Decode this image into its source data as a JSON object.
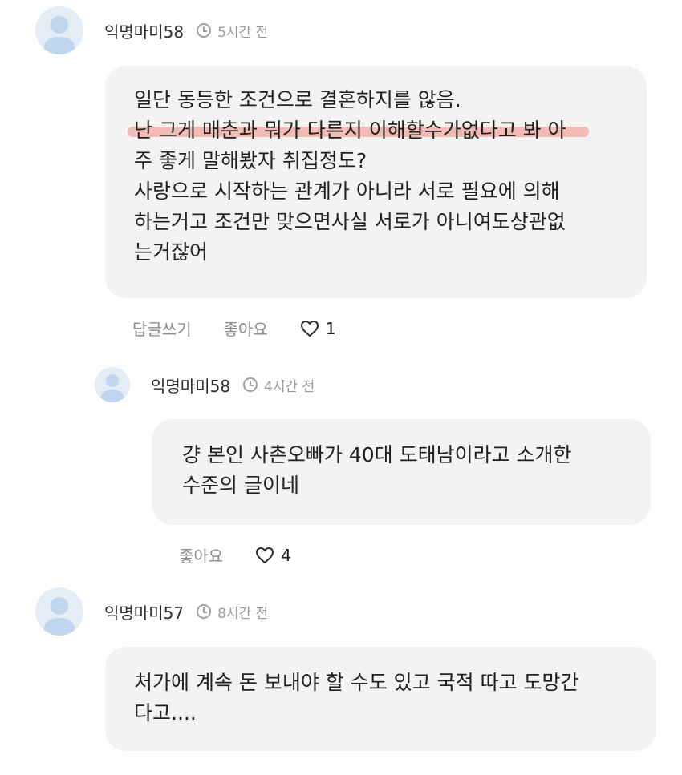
{
  "comments": [
    {
      "author": "익명마미58",
      "time": "5시간 전",
      "lines": [
        "일단 동등한 조건으로 결혼하지를 않음.",
        "난 그게 매춘과 뭐가 다른지 이해할수가없다고 봐 아",
        "주 좋게 말해봤자 취집정도?",
        "사랑으로 시작하는 관계가 아니라 서로 필요에 의해",
        "하는거고 조건만 맞으면사실 서로가 아니여도상관없",
        "는거잖어"
      ],
      "reply_label": "답글쓰기",
      "like_label": "좋아요",
      "like_count": "1"
    },
    {
      "author": "익명마미58",
      "time": "4시간 전",
      "lines": [
        "걍 본인 사촌오빠가 40대 도태남이라고 소개한",
        "수준의 글이네"
      ],
      "like_label": "좋아요",
      "like_count": "4"
    },
    {
      "author": "익명마미57",
      "time": "8시간 전",
      "lines": [
        "처가에 계속 돈 보내야 할 수도 있고 국적 따고 도망간",
        "다고...."
      ]
    }
  ],
  "colors": {
    "bubble_bg": "#f3f3f4",
    "highlight": "#f28c82",
    "avatar_bg": "#e4ecf6",
    "avatar_fg": "#bfd6ee"
  }
}
